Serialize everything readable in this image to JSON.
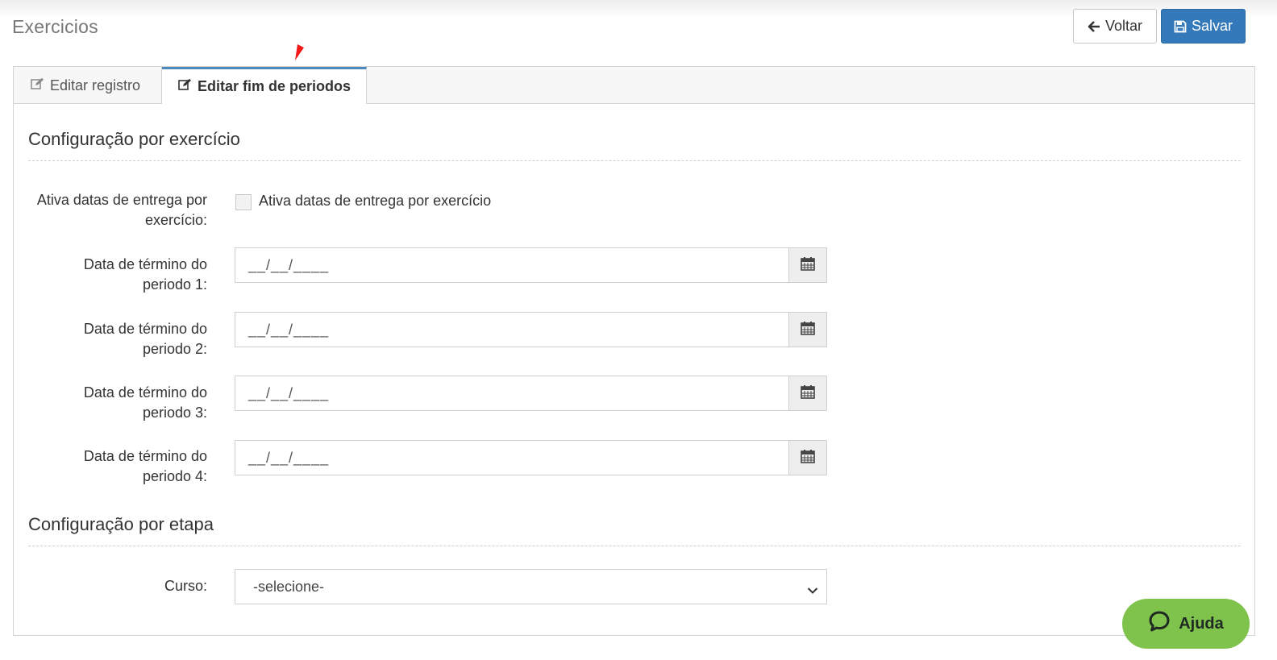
{
  "page": {
    "title": "Exercicios"
  },
  "toolbar": {
    "back_label": "Voltar",
    "save_label": "Salvar"
  },
  "tabs": [
    {
      "label": "Editar registro",
      "icon": "edit-icon",
      "active": false
    },
    {
      "label": "Editar fim de periodos",
      "icon": "edit-icon",
      "active": true
    }
  ],
  "section1": {
    "title": "Configuração por exercício",
    "checkbox_field": {
      "label_line1": "Ativa datas de entrega por",
      "label_line2": "exercício:",
      "checkbox_label": "Ativa datas de entrega por exercício",
      "checked": false
    },
    "periods": [
      {
        "label_line1": "Data de término do",
        "label_line2": "periodo 1:",
        "value": "__/__/____"
      },
      {
        "label_line1": "Data de término do",
        "label_line2": "periodo 2:",
        "value": "__/__/____"
      },
      {
        "label_line1": "Data de término do",
        "label_line2": "periodo 3:",
        "value": "__/__/____"
      },
      {
        "label_line1": "Data de término do",
        "label_line2": "periodo 4:",
        "value": "__/__/____"
      }
    ]
  },
  "section2": {
    "title": "Configuração por etapa",
    "course": {
      "label": "Curso:",
      "selected": "-selecione-"
    }
  },
  "help": {
    "label": "Ajuda"
  },
  "colors": {
    "primary": "#3479b9",
    "help": "#7fc24c",
    "tab_accent": "#4b8bbf"
  }
}
